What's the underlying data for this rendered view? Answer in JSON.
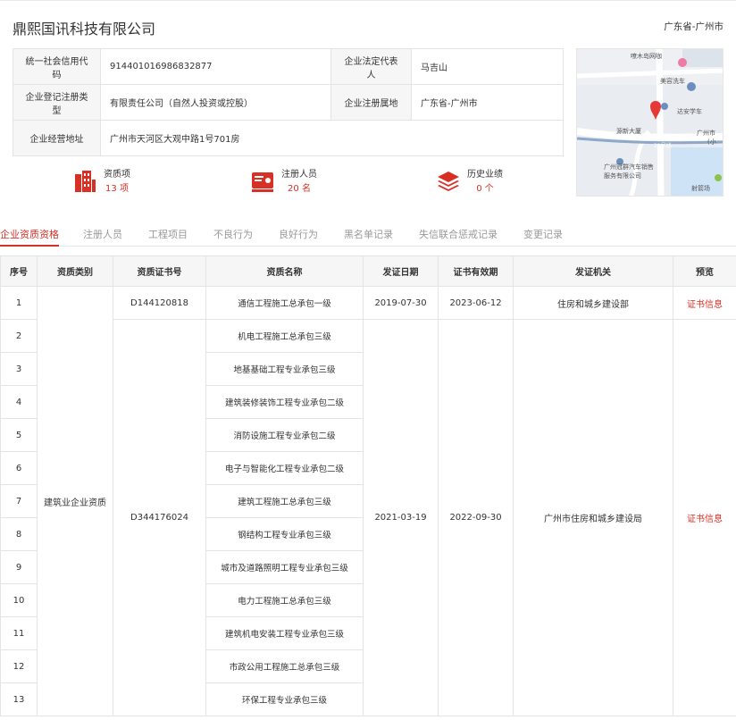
{
  "company": {
    "name": "鼎熙国讯科技有限公司",
    "region": "广东省-广州市"
  },
  "info": {
    "credit_code_label": "统一社会信用代码",
    "credit_code": "91440101698683​2877",
    "legal_rep_label": "企业法定代表人",
    "legal_rep": "马吉山",
    "reg_type_label": "企业登记注册类型",
    "reg_type": "有限责任公司（自然人投资或控股）",
    "reg_place_label": "企业注册属地",
    "reg_place": "广东省-广州市",
    "address_label": "企业经营地址",
    "address": "广州市天河区大观中路1号701房"
  },
  "map": {
    "labels": [
      "嘹木岛网咖",
      "美容洗车",
      "达安学车",
      "源新大厦",
      "广州冠群汽车销售",
      "服务有限公司",
      "射箭场",
      "广州市",
      "(小"
    ],
    "road_label": "21号线"
  },
  "stats": [
    {
      "label": "资质项",
      "value": "13 项"
    },
    {
      "label": "注册人员",
      "value": "20 名"
    },
    {
      "label": "历史业绩",
      "value": "0 个"
    }
  ],
  "tabs": [
    "企业资质资格",
    "注册人员",
    "工程项目",
    "不良行为",
    "良好行为",
    "黑名单记录",
    "失信联合惩戒记录",
    "变更记录"
  ],
  "table": {
    "headers": [
      "序号",
      "资质类别",
      "资质证书号",
      "资质名称",
      "发证日期",
      "证书有效期",
      "发证机关",
      "预览"
    ],
    "category": "建筑业企业资质",
    "cert1": {
      "no": "D144120818",
      "issue": "2019-07-30",
      "expire": "2023-06-12",
      "authority": "住房和城乡建设部",
      "preview": "证书信息"
    },
    "cert2": {
      "no": "D344176024",
      "issue": "2021-03-19",
      "expire": "2022-09-30",
      "authority": "广州市住房和城乡建设局",
      "preview": "证书信息"
    },
    "rows": [
      {
        "idx": "1",
        "name": "通信工程施工总承包一级"
      },
      {
        "idx": "2",
        "name": "机电工程施工总承包三级"
      },
      {
        "idx": "3",
        "name": "地基基础工程专业承包三级"
      },
      {
        "idx": "4",
        "name": "建筑装修装饰工程专业承包二级"
      },
      {
        "idx": "5",
        "name": "消防设施工程专业承包二级"
      },
      {
        "idx": "6",
        "name": "电子与智能化工程专业承包二级"
      },
      {
        "idx": "7",
        "name": "建筑工程施工总承包三级"
      },
      {
        "idx": "8",
        "name": "钢结构工程专业承包三级"
      },
      {
        "idx": "9",
        "name": "城市及道路照明工程专业承包三级"
      },
      {
        "idx": "10",
        "name": "电力工程施工总承包三级"
      },
      {
        "idx": "11",
        "name": "建筑机电安装工程专业承包三级"
      },
      {
        "idx": "12",
        "name": "市政公用工程施工总承包三级"
      },
      {
        "idx": "13",
        "name": "环保工程专业承包三级"
      }
    ]
  },
  "colors": {
    "accent": "#d93025",
    "border": "#e4e4e4",
    "header_bg": "#f6f6f6"
  }
}
